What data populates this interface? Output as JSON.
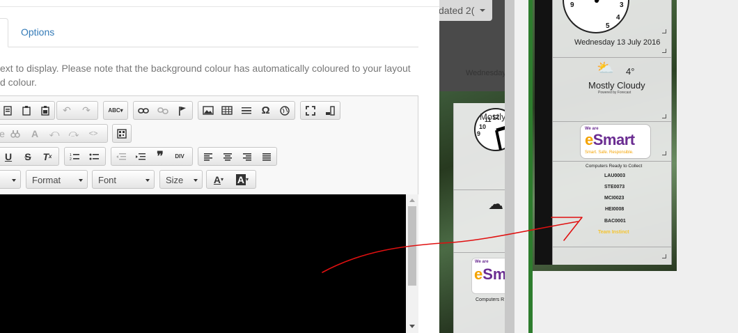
{
  "dialog": {
    "tabs": [
      {
        "label": "Options"
      }
    ],
    "help_text": {
      "line1": "ext to display. Please note that the background colour has automatically coloured to your layout",
      "line2": "d colour."
    },
    "toolbar": {
      "format_label": "Format",
      "font_label": "Font",
      "size_label": "Size"
    }
  },
  "background": {
    "updated_label": "dated 2("
  },
  "preview": {
    "clock_numbers": [
      "9",
      "3",
      "4",
      "5"
    ],
    "date": "Wednesday 13 July 2016",
    "temperature": "4°",
    "weather": "Mostly Cloudy",
    "powered_by": "Powered by Forecast",
    "esmart": {
      "we_are": "We are",
      "name_e": "e",
      "name_rest": "Smart",
      "tagline": "Smart. Safe. Responsible."
    },
    "computers_title": "Computers Ready to Collect",
    "computers": [
      "LAU0003",
      "STE0073",
      "MCI0023",
      "HEI0008",
      "BAC0001"
    ],
    "team": "Team Instinct",
    "mid_date": "Wednesday",
    "mid_weather": "Mostly",
    "mid_computers": "Computers R",
    "mid_clock_numbers": [
      "11",
      "12",
      "10",
      "9"
    ]
  },
  "colors": {
    "link": "#337ab7",
    "annotation_stroke": "#e01010",
    "esmart_purple": "#6a2c91",
    "esmart_orange": "#f4a300",
    "green_line": "#2e7d2e"
  }
}
